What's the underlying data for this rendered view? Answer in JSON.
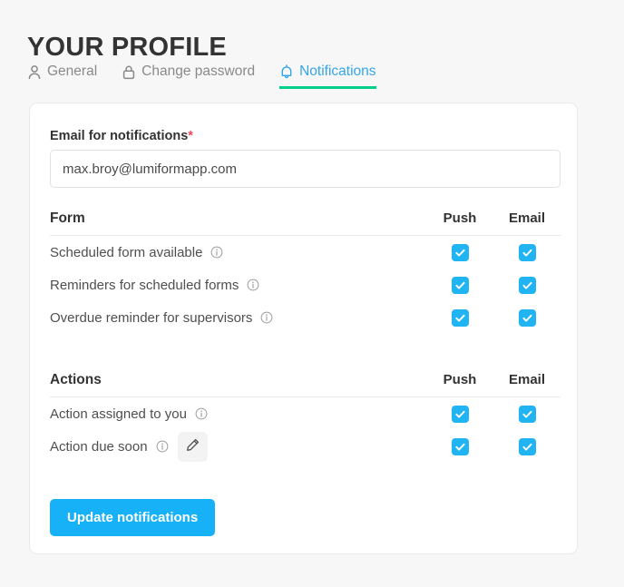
{
  "page": {
    "title": "YOUR PROFILE"
  },
  "tabs": [
    {
      "label": "General",
      "icon": "user-icon",
      "active": false
    },
    {
      "label": "Change password",
      "icon": "lock-icon",
      "active": false
    },
    {
      "label": "Notifications",
      "icon": "bell-icon",
      "active": true
    }
  ],
  "email_field": {
    "label": "Email for notifications",
    "required_marker": "*",
    "value": "max.broy@lumiformapp.com",
    "placeholder": "Email for notifications"
  },
  "sections": [
    {
      "title": "Form",
      "columns": [
        "Push",
        "Email"
      ],
      "rows": [
        {
          "label": "Scheduled form available",
          "info": true,
          "edit": false,
          "push": true,
          "email": true
        },
        {
          "label": "Reminders for scheduled forms",
          "info": true,
          "edit": false,
          "push": true,
          "email": true
        },
        {
          "label": "Overdue reminder for supervisors",
          "info": true,
          "edit": false,
          "push": true,
          "email": true
        }
      ]
    },
    {
      "title": "Actions",
      "columns": [
        "Push",
        "Email"
      ],
      "rows": [
        {
          "label": "Action assigned to you",
          "info": true,
          "edit": false,
          "push": true,
          "email": true
        },
        {
          "label": "Action due soon",
          "info": true,
          "edit": true,
          "push": true,
          "email": true
        }
      ]
    }
  ],
  "submit": {
    "label": "Update notifications"
  },
  "colors": {
    "accent_blue": "#16b1f7",
    "checkbox_blue": "#21b4f2",
    "tab_active_text": "#34a6e8",
    "tab_underline_green": "#00d08a",
    "required_red": "#f0455e",
    "page_background": "#f7f7f7",
    "card_background": "#ffffff",
    "text_dark": "#333333",
    "text_muted": "#8a8a8a"
  }
}
